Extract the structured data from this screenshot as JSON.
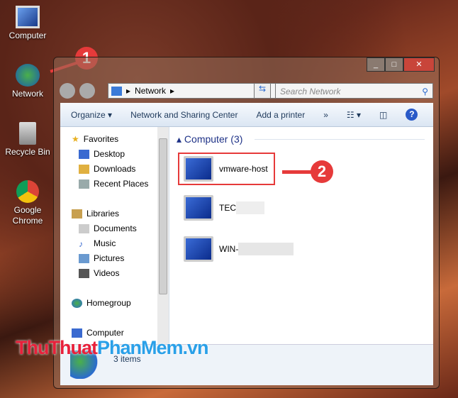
{
  "desktop": {
    "icons": [
      {
        "label": "Computer"
      },
      {
        "label": "Network"
      },
      {
        "label": "Recycle Bin"
      },
      {
        "label": "Google Chrome"
      }
    ]
  },
  "window": {
    "address": "Network",
    "search_placeholder": "Search Network",
    "toolbar": {
      "organize": "Organize",
      "sharing": "Network and Sharing Center",
      "printer": "Add a printer",
      "more": "»"
    },
    "nav": {
      "favorites": "Favorites",
      "desktop": "Desktop",
      "downloads": "Downloads",
      "recent": "Recent Places",
      "libraries": "Libraries",
      "documents": "Documents",
      "music": "Music",
      "pictures": "Pictures",
      "videos": "Videos",
      "homegroup": "Homegroup",
      "computer": "Computer"
    },
    "group_header": "Computer (3)",
    "computers": [
      "vmware-host",
      "TEC",
      "WIN-"
    ],
    "status": "3 items"
  },
  "annotations": [
    "1",
    "2"
  ],
  "watermark": {
    "part1": "ThuThuat",
    "part2": "PhanMem",
    "part3": ".vn"
  },
  "colors": {
    "accent": "#e63a3a",
    "link": "#1e395b"
  }
}
